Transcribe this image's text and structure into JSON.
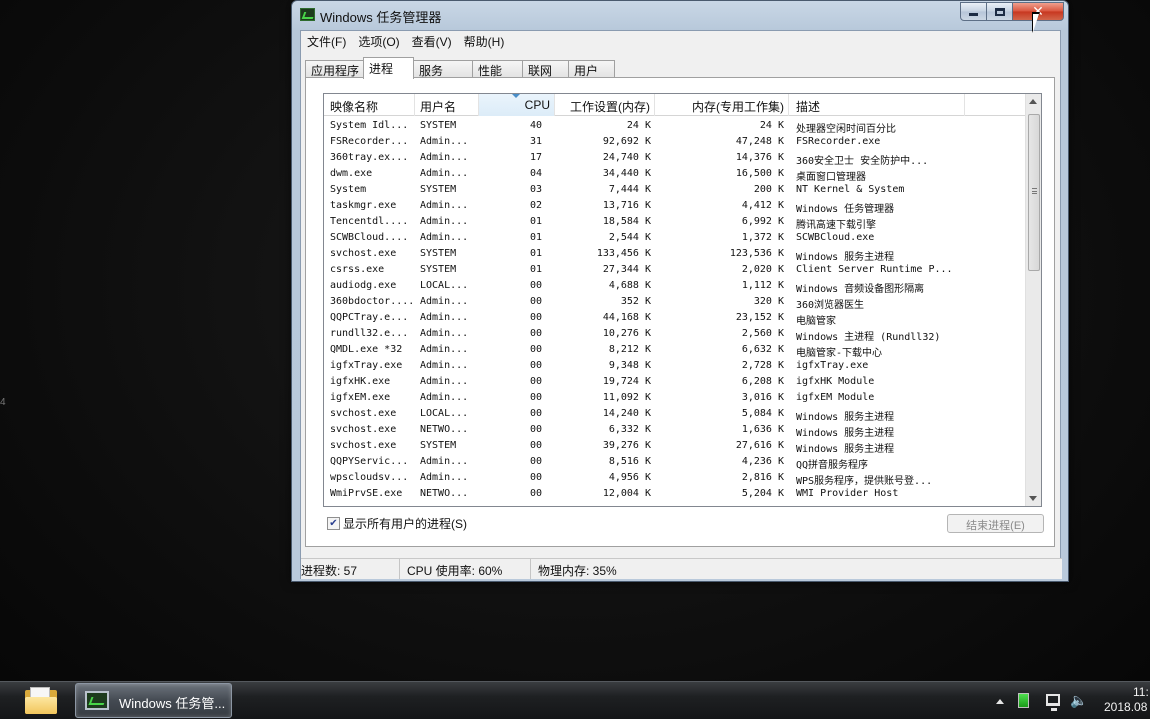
{
  "window": {
    "title": "Windows 任务管理器",
    "close_symbol": "✕"
  },
  "menu": [
    "文件(F)",
    "选项(O)",
    "查看(V)",
    "帮助(H)"
  ],
  "tabs": [
    "应用程序",
    "进程",
    "服务",
    "性能",
    "联网",
    "用户"
  ],
  "active_tab": "进程",
  "columns": {
    "name": "映像名称",
    "user": "用户名",
    "cpu": "CPU",
    "working_set": "工作设置(内存)",
    "private_memory": "内存(专用工作集)",
    "description": "描述"
  },
  "sorted_column": "CPU",
  "processes": [
    {
      "name": "System Idl...",
      "user": "SYSTEM",
      "cpu": "40",
      "ws": "24 K",
      "mem": "24 K",
      "desc": "处理器空闲时间百分比"
    },
    {
      "name": "FSRecorder...",
      "user": "Admin...",
      "cpu": "31",
      "ws": "92,692 K",
      "mem": "47,248 K",
      "desc": "FSRecorder.exe"
    },
    {
      "name": "360tray.ex...",
      "user": "Admin...",
      "cpu": "17",
      "ws": "24,740 K",
      "mem": "14,376 K",
      "desc": "360安全卫士 安全防护中..."
    },
    {
      "name": "dwm.exe",
      "user": "Admin...",
      "cpu": "04",
      "ws": "34,440 K",
      "mem": "16,500 K",
      "desc": "桌面窗口管理器"
    },
    {
      "name": "System",
      "user": "SYSTEM",
      "cpu": "03",
      "ws": "7,444 K",
      "mem": "200 K",
      "desc": "NT Kernel & System"
    },
    {
      "name": "taskmgr.exe",
      "user": "Admin...",
      "cpu": "02",
      "ws": "13,716 K",
      "mem": "4,412 K",
      "desc": "Windows 任务管理器"
    },
    {
      "name": "Tencentdl....",
      "user": "Admin...",
      "cpu": "01",
      "ws": "18,584 K",
      "mem": "6,992 K",
      "desc": "腾讯高速下载引擎"
    },
    {
      "name": "SCWBCloud....",
      "user": "Admin...",
      "cpu": "01",
      "ws": "2,544 K",
      "mem": "1,372 K",
      "desc": "SCWBCloud.exe"
    },
    {
      "name": "svchost.exe",
      "user": "SYSTEM",
      "cpu": "01",
      "ws": "133,456 K",
      "mem": "123,536 K",
      "desc": "Windows 服务主进程"
    },
    {
      "name": "csrss.exe",
      "user": "SYSTEM",
      "cpu": "01",
      "ws": "27,344 K",
      "mem": "2,020 K",
      "desc": "Client Server Runtime P..."
    },
    {
      "name": "audiodg.exe",
      "user": "LOCAL...",
      "cpu": "00",
      "ws": "4,688 K",
      "mem": "1,112 K",
      "desc": "Windows 音频设备图形隔离"
    },
    {
      "name": "360bdoctor....",
      "user": "Admin...",
      "cpu": "00",
      "ws": "352 K",
      "mem": "320 K",
      "desc": "360浏览器医生"
    },
    {
      "name": "QQPCTray.e...",
      "user": "Admin...",
      "cpu": "00",
      "ws": "44,168 K",
      "mem": "23,152 K",
      "desc": "电脑管家"
    },
    {
      "name": "rundll32.e...",
      "user": "Admin...",
      "cpu": "00",
      "ws": "10,276 K",
      "mem": "2,560 K",
      "desc": "Windows 主进程 (Rundll32)"
    },
    {
      "name": "QMDL.exe *32",
      "user": "Admin...",
      "cpu": "00",
      "ws": "8,212 K",
      "mem": "6,632 K",
      "desc": "电脑管家-下载中心"
    },
    {
      "name": "igfxTray.exe",
      "user": "Admin...",
      "cpu": "00",
      "ws": "9,348 K",
      "mem": "2,728 K",
      "desc": "igfxTray.exe"
    },
    {
      "name": "igfxHK.exe",
      "user": "Admin...",
      "cpu": "00",
      "ws": "19,724 K",
      "mem": "6,208 K",
      "desc": "igfxHK Module"
    },
    {
      "name": "igfxEM.exe",
      "user": "Admin...",
      "cpu": "00",
      "ws": "11,092 K",
      "mem": "3,016 K",
      "desc": "igfxEM Module"
    },
    {
      "name": "svchost.exe",
      "user": "LOCAL...",
      "cpu": "00",
      "ws": "14,240 K",
      "mem": "5,084 K",
      "desc": "Windows 服务主进程"
    },
    {
      "name": "svchost.exe",
      "user": "NETWO...",
      "cpu": "00",
      "ws": "6,332 K",
      "mem": "1,636 K",
      "desc": "Windows 服务主进程"
    },
    {
      "name": "svchost.exe",
      "user": "SYSTEM",
      "cpu": "00",
      "ws": "39,276 K",
      "mem": "27,616 K",
      "desc": "Windows 服务主进程"
    },
    {
      "name": "QQPYServic...",
      "user": "Admin...",
      "cpu": "00",
      "ws": "8,516 K",
      "mem": "4,236 K",
      "desc": "QQ拼音服务程序"
    },
    {
      "name": "wpscloudsv...",
      "user": "Admin...",
      "cpu": "00",
      "ws": "4,956 K",
      "mem": "2,816 K",
      "desc": "WPS服务程序，提供账号登..."
    },
    {
      "name": "WmiPrvSE.exe",
      "user": "NETWO...",
      "cpu": "00",
      "ws": "12,004 K",
      "mem": "5,204 K",
      "desc": "WMI Provider Host"
    }
  ],
  "show_all_users": {
    "label": "显示所有用户的进程(S)",
    "checked": true
  },
  "end_process_label": "结束进程(E)",
  "status": {
    "processes": "进程数: 57",
    "cpu": "CPU 使用率: 60%",
    "memory": "物理内存: 35%"
  },
  "taskbar": {
    "task_label": "Windows 任务管...",
    "clock_time": "11:",
    "clock_date": "2018.08"
  },
  "edge_glyph": "4"
}
